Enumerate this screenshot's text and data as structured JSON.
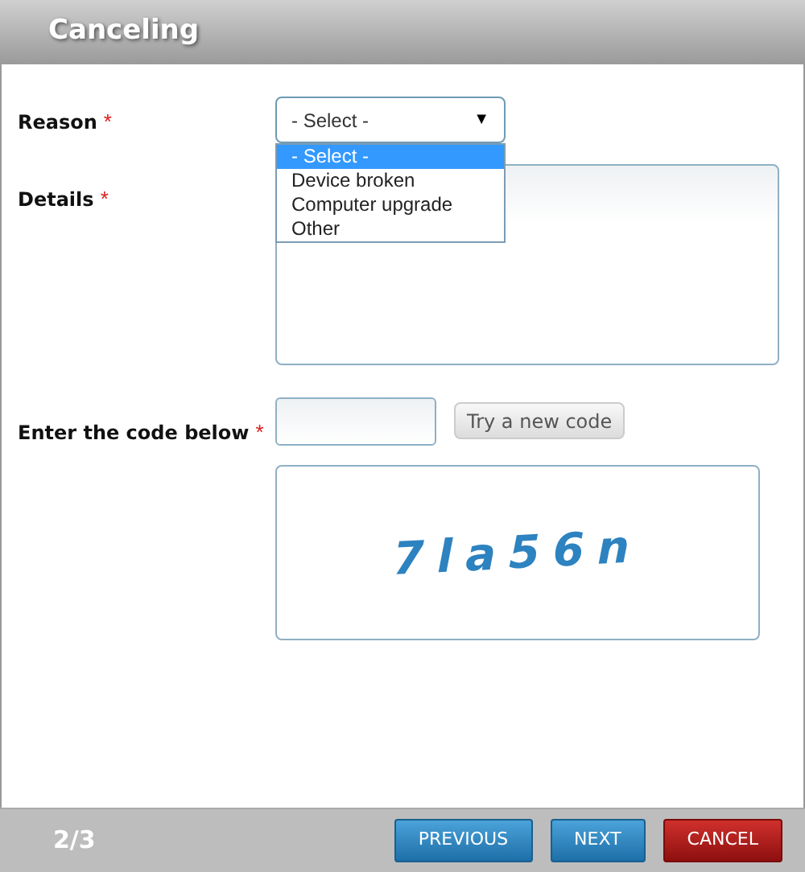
{
  "window": {
    "title": "Canceling"
  },
  "form": {
    "reason": {
      "label": "Reason",
      "required": "*",
      "value": "- Select -",
      "caret": "▼",
      "expanded": true,
      "options": [
        {
          "label": "- Select -",
          "selected": true
        },
        {
          "label": "Device broken",
          "selected": false
        },
        {
          "label": "Computer upgrade",
          "selected": false
        },
        {
          "label": "Other",
          "selected": false
        }
      ]
    },
    "details": {
      "label": "Details",
      "required": "*"
    },
    "code": {
      "label": "Enter the code below",
      "required": "*",
      "button": "Try a new code",
      "captcha": "7la56n"
    }
  },
  "footer": {
    "step": "2/3",
    "buttons": [
      {
        "label": "PREVIOUS",
        "kind": "primary"
      },
      {
        "label": "NEXT",
        "kind": "primary"
      },
      {
        "label": "CANCEL",
        "kind": "danger"
      }
    ]
  }
}
